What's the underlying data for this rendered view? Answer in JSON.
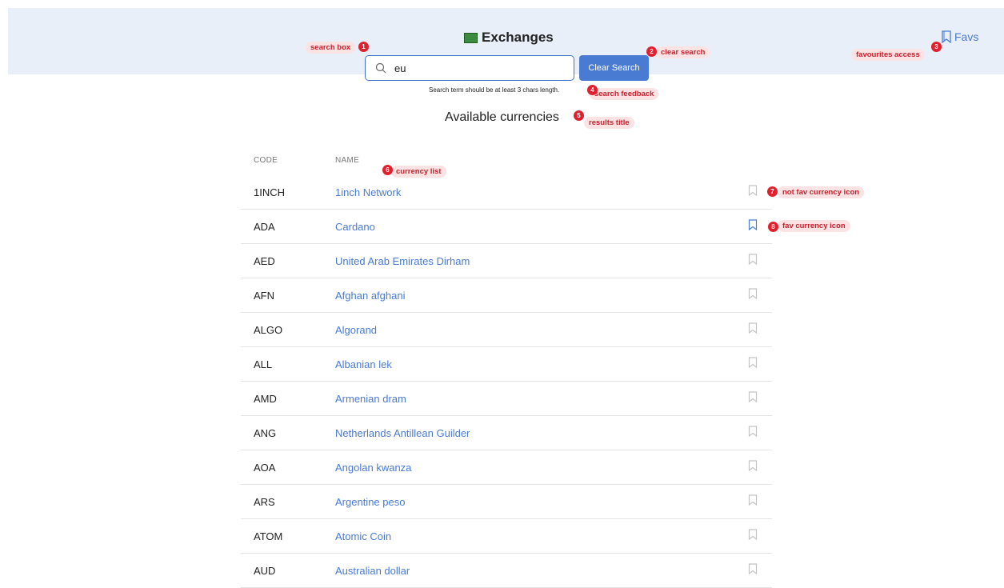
{
  "header": {
    "title": "Exchanges",
    "favs_label": "Favs"
  },
  "search": {
    "value": "eu",
    "clear_label": "Clear Search"
  },
  "feedback": "Search term should be at least 3 chars length.",
  "results_title": "Available currencies",
  "columns": {
    "code": "CODE",
    "name": "NAME"
  },
  "currencies": [
    {
      "code": "1INCH",
      "name": "1inch Network",
      "fav": false
    },
    {
      "code": "ADA",
      "name": "Cardano",
      "fav": true
    },
    {
      "code": "AED",
      "name": "United Arab Emirates Dirham",
      "fav": false
    },
    {
      "code": "AFN",
      "name": "Afghan afghani",
      "fav": false
    },
    {
      "code": "ALGO",
      "name": "Algorand",
      "fav": false
    },
    {
      "code": "ALL",
      "name": "Albanian lek",
      "fav": false
    },
    {
      "code": "AMD",
      "name": "Armenian dram",
      "fav": false
    },
    {
      "code": "ANG",
      "name": "Netherlands Antillean Guilder",
      "fav": false
    },
    {
      "code": "AOA",
      "name": "Angolan kwanza",
      "fav": false
    },
    {
      "code": "ARS",
      "name": "Argentine peso",
      "fav": false
    },
    {
      "code": "ATOM",
      "name": "Atomic Coin",
      "fav": false
    },
    {
      "code": "AUD",
      "name": "Australian dollar",
      "fav": false
    }
  ],
  "annotations": [
    {
      "num": "1",
      "label": "search box"
    },
    {
      "num": "2",
      "label": "clear search"
    },
    {
      "num": "3",
      "label": "favourites access"
    },
    {
      "num": "4",
      "label": "search feedback"
    },
    {
      "num": "5",
      "label": "results title"
    },
    {
      "num": "6",
      "label": "currency list"
    },
    {
      "num": "7",
      "label": "not fav currency  icon"
    },
    {
      "num": "8",
      "label": "fav currency icon"
    }
  ],
  "colors": {
    "accent": "#4a7bd3",
    "header_bg": "#e9eff9",
    "annotation": "#e0202e"
  }
}
